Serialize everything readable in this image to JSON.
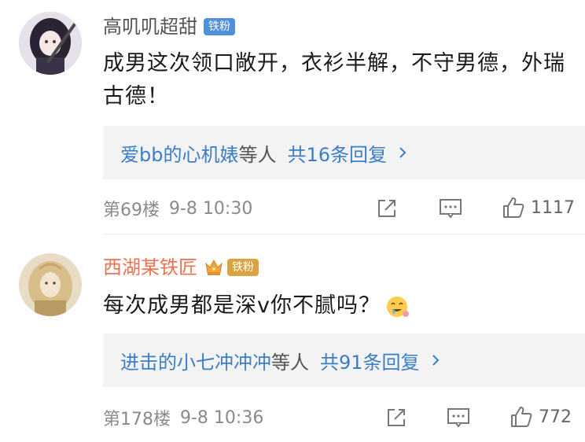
{
  "comments": [
    {
      "username": "高叽叽超甜",
      "badge": "铁粉",
      "text": "成男这次领口敞开，衣衫半解，不守男德，外瑞古德！",
      "reply_users": "爱bb的心机婊",
      "reply_etc": "等人",
      "reply_count": "共16条回复",
      "floor": "第69楼",
      "time": "9-8 10:30",
      "likes": "1117"
    },
    {
      "username": "西湖某铁匠",
      "badge": "铁粉",
      "text": "每次成男都是深v你不腻吗？",
      "emoji": "drooling-face-emoji",
      "reply_users": "进击的小七冲冲冲",
      "reply_etc": "等人",
      "reply_count": "共91条回复",
      "floor": "第178楼",
      "time": "9-8 10:36",
      "likes": "772"
    }
  ],
  "colors": {
    "link_blue": "#3b7ec8",
    "username_orange": "#eb7350",
    "reply_bg": "#f3f3f3",
    "meta_gray": "#8a8a8a"
  },
  "icons": [
    "repost-icon",
    "comment-icon",
    "like-icon",
    "chevron-right-icon",
    "crown-icon"
  ]
}
